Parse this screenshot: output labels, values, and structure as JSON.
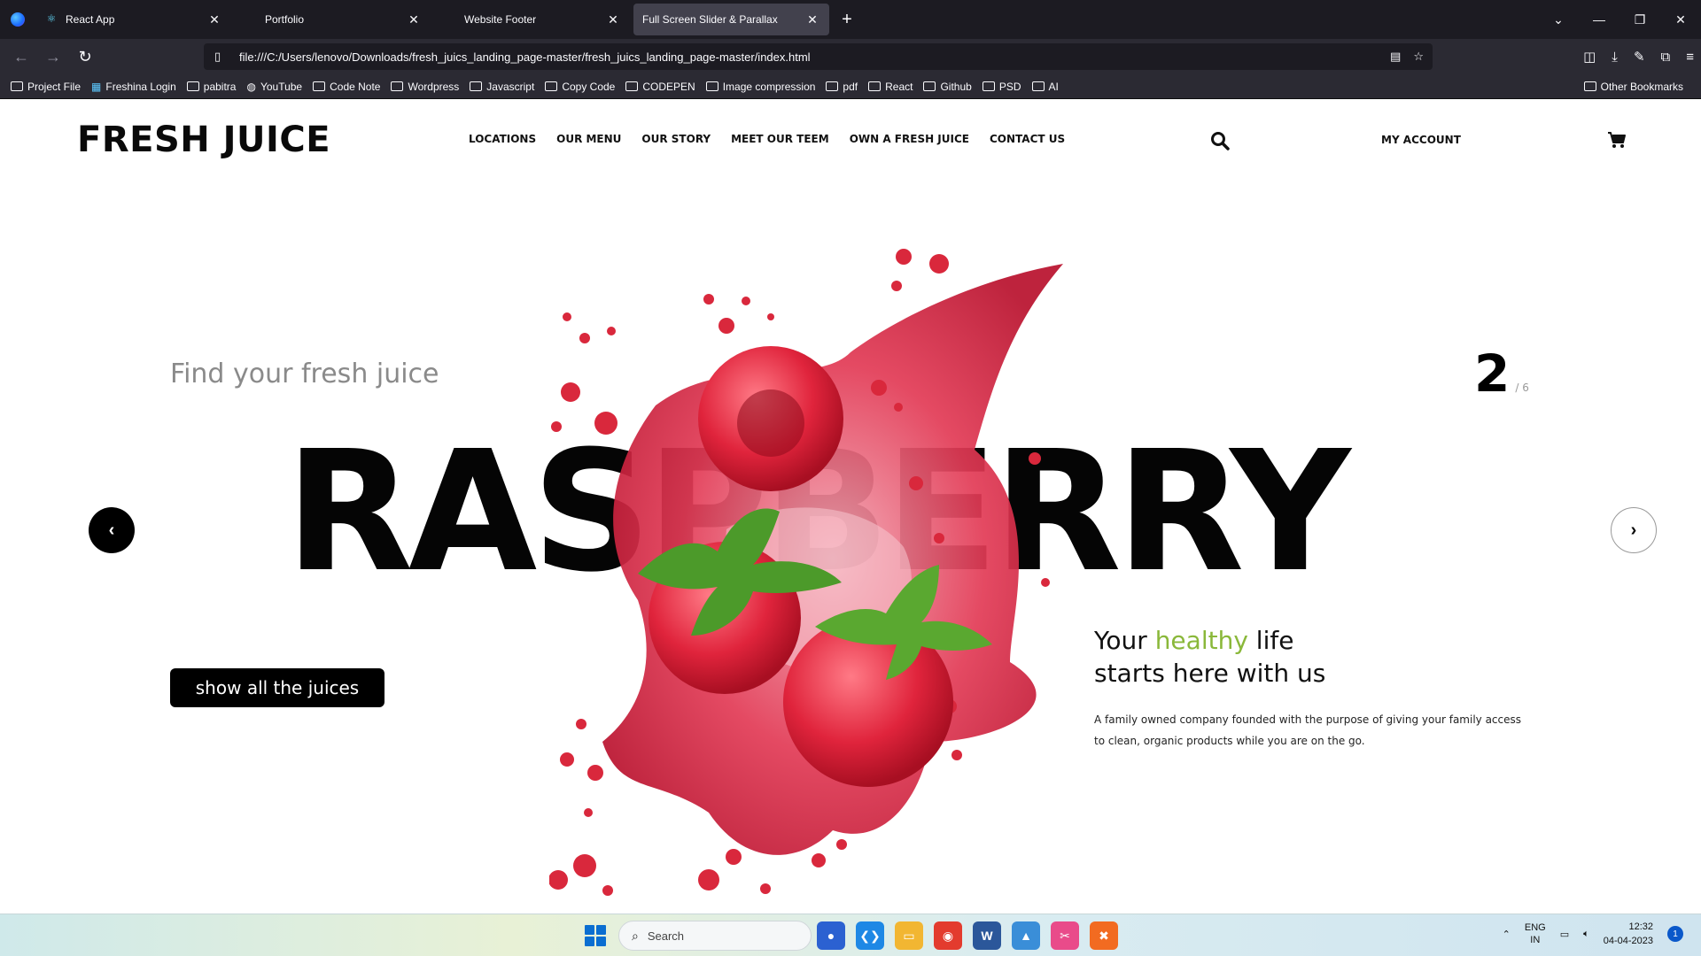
{
  "browser": {
    "tabs": [
      {
        "title": "React App",
        "icon": "react-icon",
        "active": false
      },
      {
        "title": "Portfolio",
        "icon": "",
        "active": false
      },
      {
        "title": "Website Footer",
        "icon": "",
        "active": false
      },
      {
        "title": "Full Screen Slider & Parallax",
        "icon": "",
        "active": true
      }
    ],
    "url": "file:///C:/Users/lenovo/Downloads/fresh_juics_landing_page-master/fresh_juics_landing_page-master/index.html",
    "bookmarks": [
      "Project File",
      "Freshina Login",
      "pabitra",
      "YouTube",
      "Code Note",
      "Wordpress",
      "Javascript",
      "Copy Code",
      "CODEPEN",
      "Image compression",
      "pdf",
      "React",
      "Github",
      "PSD",
      "AI"
    ],
    "other_bookmarks": "Other Bookmarks"
  },
  "site": {
    "logo": "FRESH JUICE",
    "nav": [
      "LOCATIONS",
      "OUR MENU",
      "OUR STORY",
      "MEET OUR TEEM",
      "OWN A FRESH JUICE",
      "CONTACT US"
    ],
    "account": "MY ACCOUNT",
    "hero": {
      "subhead": "Find your fresh juice",
      "title": "RASPBERRY",
      "slide_current": "2",
      "slide_total": "/ 6",
      "cta": "show all the juices",
      "tagline_pre": "Your ",
      "tagline_accent": "healthy",
      "tagline_post": " life",
      "tagline_line2": "starts here with us",
      "description": "A family owned company founded with the purpose of giving your family access to clean, organic products while you are on the go."
    },
    "colors": {
      "accent": "#8ab83a",
      "primary": "#000000",
      "berry": "#d9283c"
    }
  },
  "taskbar": {
    "search_placeholder": "Search",
    "lang_line1": "ENG",
    "lang_line2": "IN",
    "time": "12:32",
    "date": "04-04-2023",
    "notifications": "1"
  }
}
